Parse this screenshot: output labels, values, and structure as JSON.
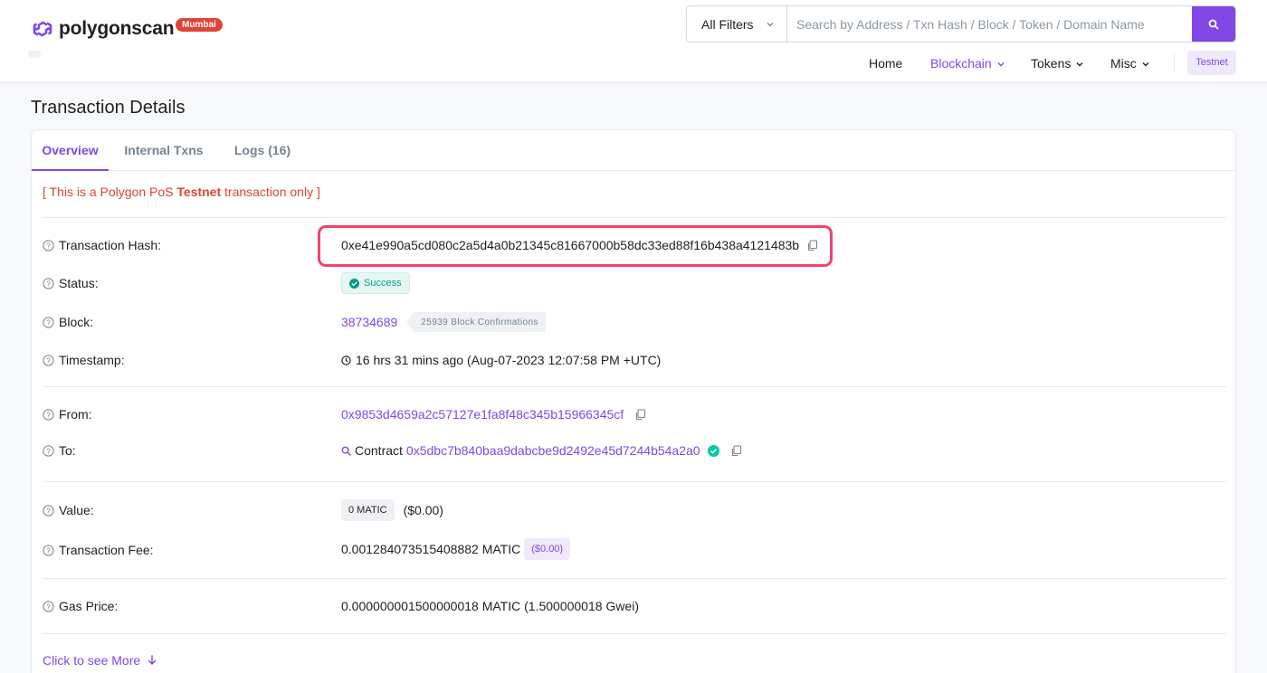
{
  "brand": {
    "name": "polygonscan",
    "network_badge": "Mumbai",
    "color": "#8247e5"
  },
  "search": {
    "filter_label": "All Filters",
    "placeholder": "Search by Address / Txn Hash / Block / Token / Domain Name",
    "button_icon": "search-icon"
  },
  "nav": {
    "items": [
      {
        "label": "Home"
      },
      {
        "label": "Blockchain"
      },
      {
        "label": "Tokens"
      },
      {
        "label": "Misc"
      }
    ],
    "testnet_badge": "Testnet"
  },
  "page": {
    "title": "Transaction Details"
  },
  "tabs": [
    {
      "label": "Overview",
      "active": true
    },
    {
      "label": "Internal Txns",
      "active": false
    },
    {
      "label": "Logs (16)",
      "active": false
    }
  ],
  "notice": {
    "prefix": "[ This is a Polygon PoS ",
    "bold": "Testnet",
    "suffix": " transaction only ]"
  },
  "details": {
    "hash_label": "Transaction Hash:",
    "hash_value": "0xe41e990a5cd080c2a5d4a0b21345c81667000b58dc33ed88f16b438a4121483b",
    "status_label": "Status:",
    "status_value": "Success",
    "block_label": "Block:",
    "block_value": "38734689",
    "block_confirmations": "25939 Block Confirmations",
    "timestamp_label": "Timestamp:",
    "timestamp_value": "16 hrs 31 mins ago (Aug-07-2023 12:07:58 PM +UTC)",
    "from_label": "From:",
    "from_value": "0x9853d4659a2c57127e1fa8f48c345b15966345cf",
    "to_label": "To:",
    "to_prefix": "Contract",
    "to_value": "0x5dbc7b840baa9dabcbe9d2492e45d7244b54a2a0",
    "value_label": "Value:",
    "value_amount": "0 MATIC",
    "value_usd": "($0.00)",
    "fee_label": "Transaction Fee:",
    "fee_value": "0.001284073515408882 MATIC",
    "fee_usd": "($0.00)",
    "gas_label": "Gas Price:",
    "gas_value": "0.000000001500000018 MATIC (1.500000018 Gwei)"
  },
  "more_link": "Click to see More"
}
